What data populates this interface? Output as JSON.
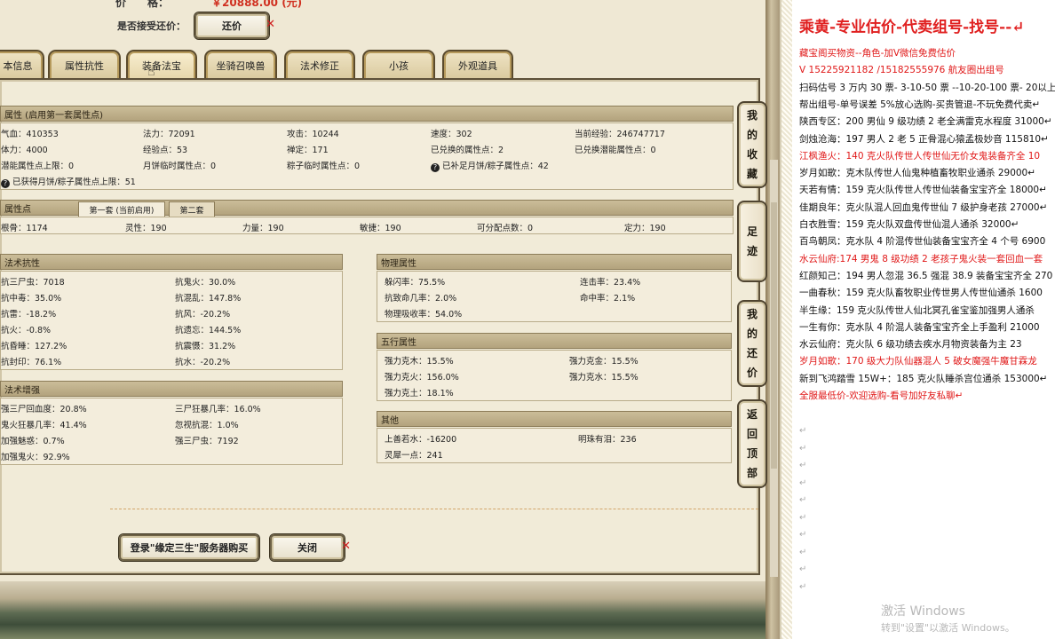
{
  "top": {
    "price_label": "价　　格：",
    "price_value": "￥20888.00 (元)",
    "bargain_label": "是否接受还价：",
    "bargain_button": "还价"
  },
  "tabs": [
    {
      "label": "本信息"
    },
    {
      "label": "属性抗性"
    },
    {
      "label": "装备法宝"
    },
    {
      "label": "坐骑召唤兽"
    },
    {
      "label": "法术修正"
    },
    {
      "label": "小孩"
    },
    {
      "label": "外观道具"
    }
  ],
  "attributes": {
    "header": "属性 (启用第一套属性点)",
    "row1": [
      "气血：410353",
      "法力：72091",
      "攻击：10244",
      "速度：302",
      "当前经验：246747717"
    ],
    "row2": [
      "体力：4000",
      "经验点：53",
      "禅定：171",
      "已兑换的属性点：2",
      "已兑换潜能属性点：0"
    ],
    "row3": [
      "潜能属性点上限：0",
      "月饼临时属性点：0",
      "粽子临时属性点：0",
      "已补足月饼/粽子属性点：42"
    ],
    "row4": "已获得月饼/粽子属性点上限：51"
  },
  "points": {
    "header": "属性点",
    "subtab1": "第一套 (当前启用)",
    "subtab2": "第二套",
    "values": [
      "根骨：1174",
      "灵性：190",
      "力量：190",
      "敏捷：190",
      "可分配点数：0",
      "定力：190"
    ]
  },
  "resist": {
    "header": "法术抗性",
    "items": [
      "抗三尸虫：7018",
      "抗鬼火：30.0%",
      "抗中毒：35.0%",
      "抗混乱：147.8%",
      "抗雷：-18.2%",
      "抗风：-20.2%",
      "抗火：-0.8%",
      "抗遗忘：144.5%",
      "抗昏睡：127.2%",
      "抗震慑：31.2%",
      "抗封印：76.1%",
      "抗水：-20.2%"
    ]
  },
  "physical": {
    "header": "物理属性",
    "items": [
      "躲闪率：75.5%",
      "连击率：23.4%",
      "抗致命几率：2.0%",
      "命中率：2.1%",
      "物理吸收率：54.0%"
    ]
  },
  "enhance": {
    "header": "法术增强",
    "items": [
      "强三尸回血度：20.8%",
      "三尸狂暴几率：16.0%",
      "鬼火狂暴几率：41.4%",
      "忽视抗混：1.0%",
      "加强魅惑：0.7%",
      "强三尸虫：7192",
      "加强鬼火：92.9%"
    ]
  },
  "five": {
    "header": "五行属性",
    "items": [
      "强力克木：15.5%",
      "强力克金：15.5%",
      "强力克火：156.0%",
      "强力克水：15.5%",
      "强力克土：18.1%"
    ]
  },
  "other": {
    "header": "其他",
    "items": [
      "上善若水：-16200",
      "明珠有泪：236",
      "灵犀一点：241"
    ]
  },
  "bottom": {
    "login_button": "登录\"缘定三生\"服务器购买",
    "close_button": "关闭"
  },
  "side": [
    {
      "label": "我的收藏",
      "chars": [
        "我",
        "的",
        "收",
        "藏"
      ]
    },
    {
      "label": "足迹",
      "chars": [
        "足",
        "迹"
      ]
    },
    {
      "label": "我的还价",
      "chars": [
        "我",
        "的",
        "还",
        "价"
      ]
    },
    {
      "label": "返回顶部",
      "chars": [
        "返",
        "回",
        "顶",
        "部"
      ]
    }
  ],
  "doc": {
    "title": "乘黄-专业估价-代卖组号-找号--↵",
    "lines": [
      {
        "text": "藏宝阁买物资--角色-加V微信免费估价",
        "red": true
      },
      {
        "text": "V 15225921182 /15182555976 航友圈出组号",
        "red": true
      },
      {
        "text": "扫码估号 3 万内 30 票- 3-10-50 票 --10-20-100 票- 20以上",
        "red": false
      },
      {
        "text": "帮出组号-单号误差 5%放心选购-买贵管退-不玩免费代卖↵",
        "red": false
      },
      {
        "text": "陕西专区：200 男仙 9 级功绩 2 老全满雷克水程度 31000↵",
        "red": false
      },
      {
        "text": "剑烛沧海：197 男人 2 老 5 正骨混心猿孟极妙音 115810↵",
        "red": false
      },
      {
        "text": "江枫渔火：140 克火队传世人传世仙无价女鬼装备齐全 10",
        "red": true
      },
      {
        "text": "岁月如歌：克木队传世人仙鬼种植畜牧职业通杀 29000↵",
        "red": false
      },
      {
        "text": "天若有情：159 克火队传世人传世仙装备宝宝齐全 18000↵",
        "red": false
      },
      {
        "text": "佳期良年：克火队混人回血鬼传世仙 7 级护身老孩 27000↵",
        "red": false
      },
      {
        "text": "白衣胜雪：159 克火队双盘传世仙混人通杀 32000↵",
        "red": false
      },
      {
        "text": "百鸟朝凤：克水队 4 阶混传世仙装备宝宝齐全 4 个号 6900",
        "red": false
      },
      {
        "text": "水云仙府:174 男鬼 8 级功绩 2 老孩子鬼火装一套回血一套",
        "red": true
      },
      {
        "text": "红颜知己：194 男人忽混 36.5 强混 38.9 装备宝宝齐全 270",
        "red": false
      },
      {
        "text": "一曲春秋：159 克火队畜牧职业传世男人传世仙通杀 1600",
        "red": false
      },
      {
        "text": "半生缘：159 克火队传世人仙北冥孔雀宝鉴加强男人通杀",
        "red": false
      },
      {
        "text": "一生有你：克水队 4 阶混人装备宝宝齐全上手盈利 21000",
        "red": false
      },
      {
        "text": "水云仙府：克火队 6 级功绩去疾水月物资装备为主 23",
        "red": false
      },
      {
        "text": "岁月如歌：170 级大力队仙器混人 5 破女魔强牛魔甘霖龙",
        "red": true
      },
      {
        "text": "新到飞鸿踏雪 15W+：185 克火队睡杀宫位通杀 153000↵",
        "red": false
      },
      {
        "text": "全服最低价-欢迎选购-看号加好友私聊↵",
        "red": true
      }
    ],
    "watermark_title": "激活 Windows",
    "watermark_sub": "转到\"设置\"以激活 Windows。"
  }
}
